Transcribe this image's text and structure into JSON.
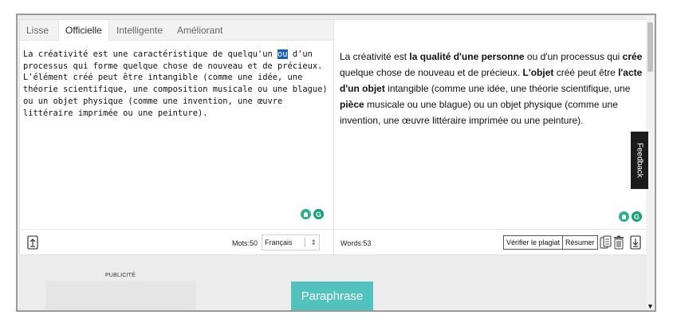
{
  "tabs": [
    {
      "label": "Lisse"
    },
    {
      "label": "Officielle"
    },
    {
      "label": "Intelligente"
    },
    {
      "label": "Améliorant"
    }
  ],
  "input": {
    "before": "La créativité est une caractéristique de quelqu'un ",
    "selected": "ou",
    "after": " d'un processus qui forme quelque chose de nouveau et de précieux. L'élément créé peut être intangible (comme une idée, une théorie scientifique, une composition musicale ou une blague) ou un objet physique (comme une invention, une œuvre littéraire imprimée ou une peinture).",
    "word_count": "Mots:50",
    "language": "Français"
  },
  "output": {
    "segments": [
      {
        "text": "La créativité est ",
        "bold": false
      },
      {
        "text": "la qualité d'une personne",
        "bold": true
      },
      {
        "text": " ou d'un processus qui ",
        "bold": false
      },
      {
        "text": "crée",
        "bold": true
      },
      {
        "text": " quelque chose de nouveau et de précieux. ",
        "bold": false
      },
      {
        "text": "L'objet",
        "bold": true
      },
      {
        "text": " créé peut être ",
        "bold": false
      },
      {
        "text": "l'acte d'un objet",
        "bold": true
      },
      {
        "text": " intangible (comme une idée, une théorie scientifique, une ",
        "bold": false
      },
      {
        "text": "pièce",
        "bold": true
      },
      {
        "text": " musicale ou une blague) ou un objet physique (comme une invention, une œuvre littéraire imprimée ou une peinture).",
        "bold": false
      }
    ],
    "word_count": "Words:53",
    "check_plagiarism_label": "Vérifier le plagiat",
    "summarize_label": "Résumer"
  },
  "grammar_badge": "G",
  "feedback_label": "Feedback",
  "ad_label": "PUBLICITÉ",
  "paraphrase_label": "Paraphrase",
  "colors": {
    "accent": "#52c2be",
    "highlight": "#1a5fb4",
    "icon_green": "#15a07a"
  }
}
